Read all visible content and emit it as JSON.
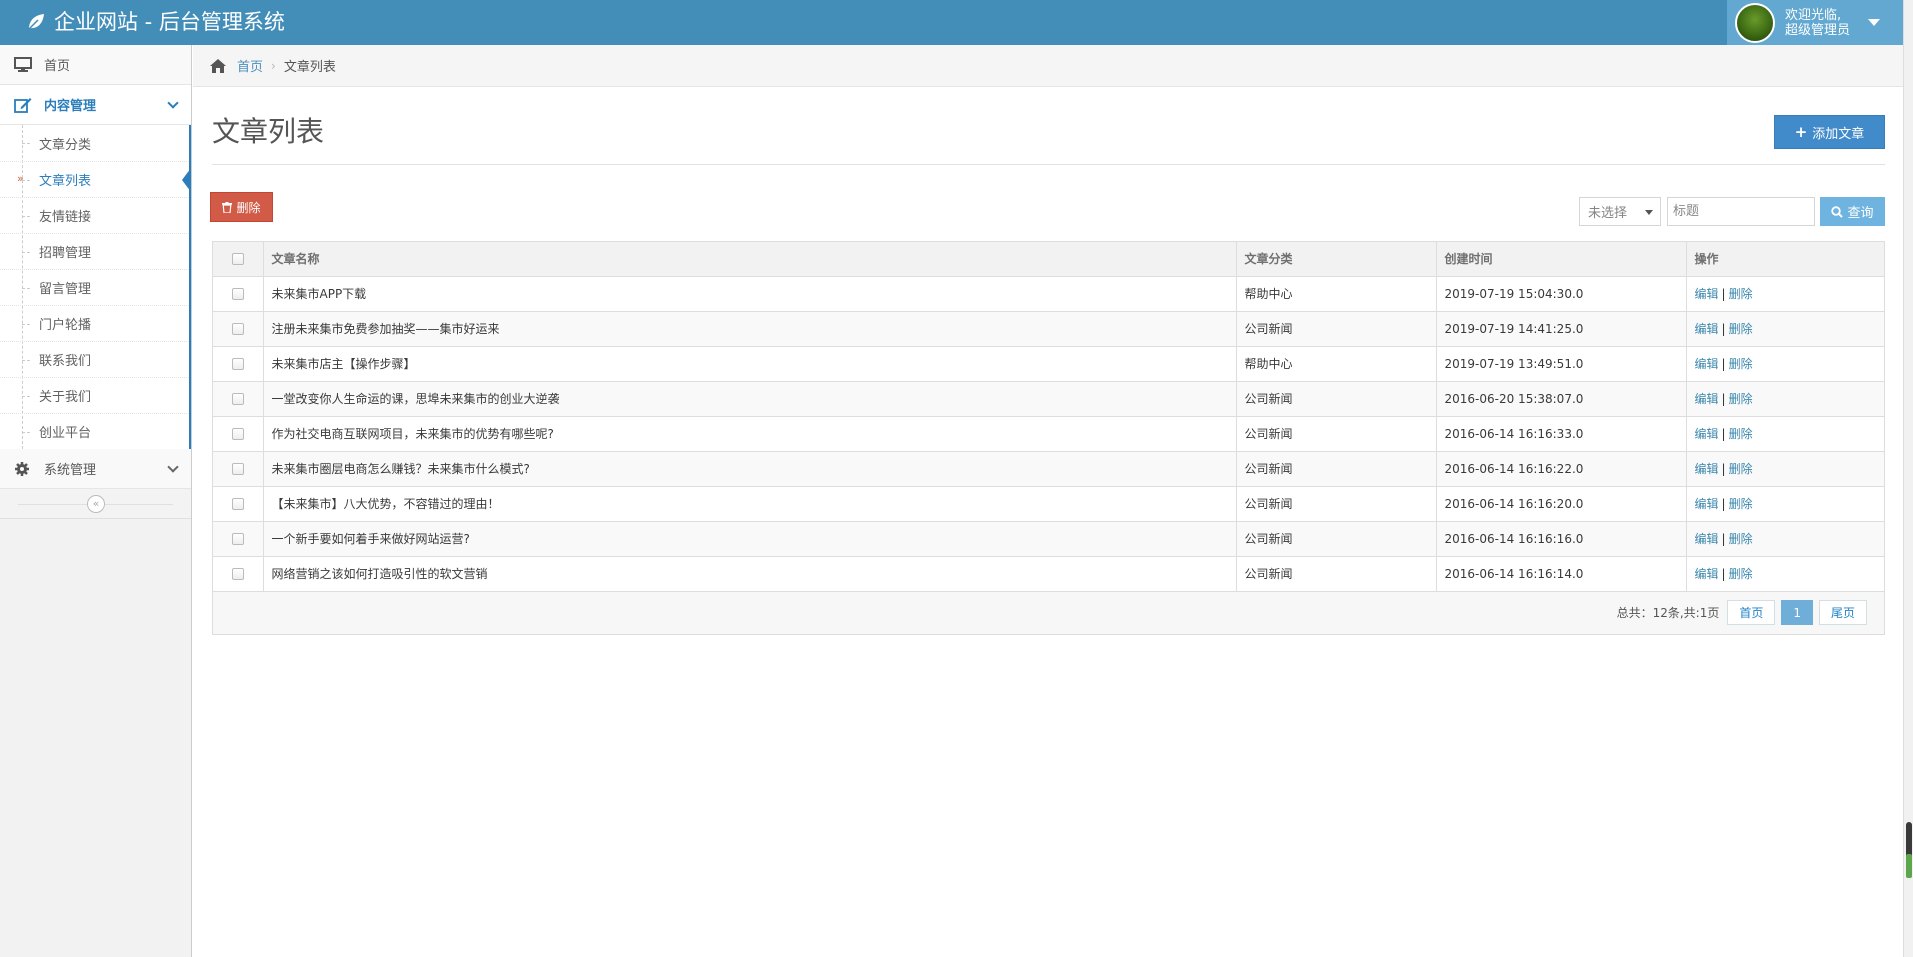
{
  "app": {
    "title": "企业网站 - 后台管理系统"
  },
  "user": {
    "line1": "欢迎光临,",
    "line2": "超级管理员"
  },
  "sidebar": {
    "home": "首页",
    "content_menu": "内容管理",
    "sub_items": [
      "文章分类",
      "文章列表",
      "友情链接",
      "招聘管理",
      "留言管理",
      "门户轮播",
      "联系我们",
      "关于我们",
      "创业平台"
    ],
    "active_sub": 1,
    "system_menu": "系统管理"
  },
  "breadcrumb": {
    "home": "首页",
    "current": "文章列表"
  },
  "page": {
    "title": "文章列表",
    "add_button": "添加文章",
    "delete_button": "删除"
  },
  "search": {
    "select_value": "未选择",
    "title_placeholder": "标题",
    "search_button": "查询"
  },
  "table": {
    "columns": [
      "文章名称",
      "文章分类",
      "创建时间",
      "操作"
    ],
    "edit_label": "编辑",
    "delete_label": "删除",
    "rows": [
      {
        "name": "未来集市APP下载",
        "category": "帮助中心",
        "created": "2019-07-19 15:04:30.0"
      },
      {
        "name": "注册未来集市免费参加抽奖——集市好运来",
        "category": "公司新闻",
        "created": "2019-07-19 14:41:25.0"
      },
      {
        "name": "未来集市店主【操作步骤】",
        "category": "帮助中心",
        "created": "2019-07-19 13:49:51.0"
      },
      {
        "name": "一堂改变你人生命运的课，思埠未来集市的创业大逆袭",
        "category": "公司新闻",
        "created": "2016-06-20 15:38:07.0"
      },
      {
        "name": "作为社交电商互联网项目，未来集市的优势有哪些呢?",
        "category": "公司新闻",
        "created": "2016-06-14 16:16:33.0"
      },
      {
        "name": "未来集市圈层电商怎么赚钱？未来集市什么模式?",
        "category": "公司新闻",
        "created": "2016-06-14 16:16:22.0"
      },
      {
        "name": "【未来集市】八大优势，不容错过的理由！",
        "category": "公司新闻",
        "created": "2016-06-14 16:16:20.0"
      },
      {
        "name": "一个新手要如何着手来做好网站运营?",
        "category": "公司新闻",
        "created": "2016-06-14 16:16:16.0"
      },
      {
        "name": "网络营销之该如何打造吸引性的软文营销",
        "category": "公司新闻",
        "created": "2016-06-14 16:16:14.0"
      }
    ]
  },
  "pager": {
    "total": "总共：12条,共:1页",
    "first": "首页",
    "current": "1",
    "last": "尾页"
  },
  "colors": {
    "navbar": "#438eb9",
    "user_area": "#62a8d1",
    "primary": "#428bca",
    "danger": "#d15b47",
    "search": "#6fb3e0",
    "link": "#2b7dbc"
  }
}
